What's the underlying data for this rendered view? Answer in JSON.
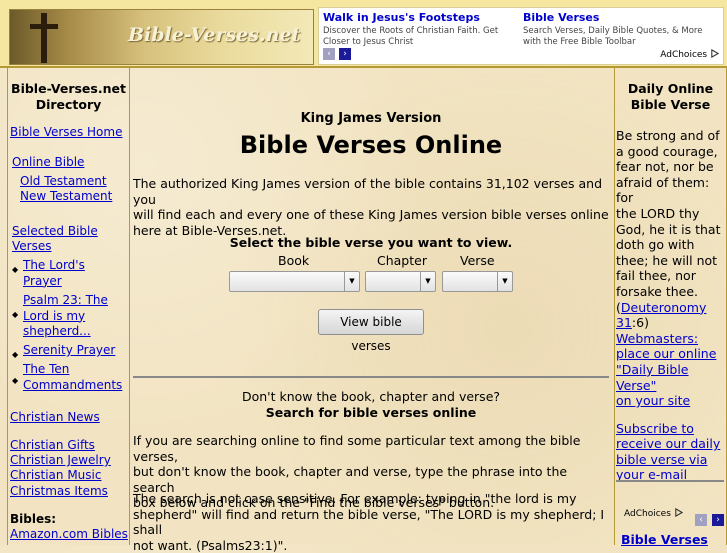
{
  "header": {
    "logo_text": "Bible-Verses.net",
    "ads": [
      {
        "title": "Walk in Jesus's Footsteps",
        "desc": "Discover the Roots of Christian Faith. Get Closer to Jesus Christ"
      },
      {
        "title": "Bible Verses",
        "desc": "Search Verses, Daily Bible Quotes, & More with the Free Bible Toolbar"
      }
    ],
    "adchoices": "AdChoices",
    "prev_arrow": "‹",
    "next_arrow": "›"
  },
  "left": {
    "directory_title_1": "Bible-Verses.net",
    "directory_title_2": "Directory",
    "home": "Bible Verses Home",
    "online_bible": "Online Bible",
    "old_testament": "Old Testament",
    "new_testament": "New Testament",
    "selected_1": "Selected Bible",
    "selected_2": "Verses",
    "verse_links": [
      {
        "l1": "The Lord's",
        "l2": "Prayer"
      },
      {
        "l1": "Psalm 23: The",
        "l2": "Lord is my",
        "l3": "shepherd..."
      },
      {
        "l1": "Serenity Prayer"
      },
      {
        "l1": "The Ten",
        "l2": "Commandments"
      }
    ],
    "christian_news": "Christian News",
    "gifts": "Christian Gifts",
    "jewelry": "Christian Jewelry",
    "music": "Christian Music",
    "christmas": "Christmas Items",
    "bibles_label": "Bibles:",
    "amazon": "Amazon.com Bibles"
  },
  "center": {
    "kjv": "King James Version",
    "title": "Bible Verses Online",
    "intro_1": "The authorized King James version of the bible contains 31,102 verses and you",
    "intro_2": "will find each and every one of these King James version bible verses online",
    "intro_3": "here at Bible-Verses.net.",
    "select_label": "Select the bible verse you want to view.",
    "book_label": "Book",
    "chapter_label": "Chapter",
    "verse_label": "Verse",
    "book_value": "",
    "chapter_value": "",
    "verse_value": "",
    "view_button": "View bible verses",
    "dont_know": "Don't know the book, chapter and verse?",
    "search_heading": "Search for bible verses online",
    "search_1": "If you are searching online to find some particular text among the bible verses,",
    "search_2": "but don't know the book, chapter and verse, type the phrase into the search",
    "search_3": "box below and click on the \"Find the bible verses\" button.",
    "case_1": "The search is not case sensitive. For example: typing in \"the lord is my",
    "case_2": "shepherd\" will find and return the bible verse, \"The LORD is my shepherd; I shall",
    "case_3": "not want. (Psalms23:1)\"."
  },
  "right": {
    "title_1": "Daily Online",
    "title_2": "Bible Verse",
    "verse_lines": [
      "Be strong and of",
      "a good courage,",
      "fear not, nor be",
      "afraid of them: for",
      "the LORD thy",
      "God, he it is that",
      "doth go with",
      "thee; he will not",
      "fail thee, nor",
      "forsake thee."
    ],
    "ref_open": "(",
    "ref_link_1": "Deuteronomy",
    "ref_link_2": "31",
    "ref_close": ":6)",
    "webmasters": [
      "Webmasters:",
      "place our online",
      "\"Daily Bible Verse\"",
      "on your site"
    ],
    "subscribe": [
      "Subscribe to",
      "receive our daily",
      "bible verse via",
      "your e-mail"
    ],
    "adchoices": "AdChoices",
    "bottom_link": "Bible Verses"
  },
  "colors": {
    "link": "#0000cc",
    "header_bg": "#f5e7a0",
    "arrow_grey": "#a0a0c0",
    "arrow_blue": "#1a1a9a"
  }
}
